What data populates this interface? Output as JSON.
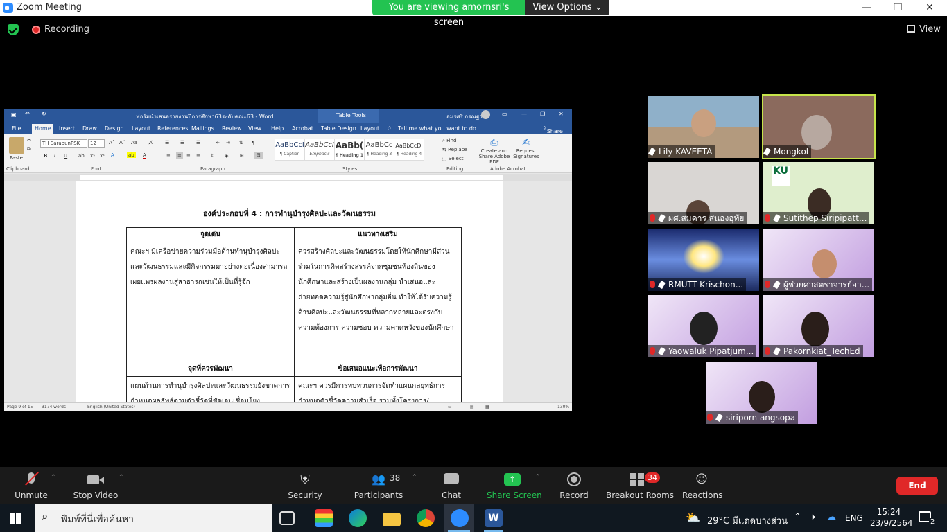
{
  "window": {
    "title": "Zoom Meeting"
  },
  "banner": {
    "text": "You are viewing amornsri's screen",
    "view_options": "View Options"
  },
  "top": {
    "recording": "Recording",
    "view": "View"
  },
  "word": {
    "title": "ฟอร์มนำเสนอรายงานปีการศึกษา63ระดับคณะ63 - Word",
    "table_tools": "Table Tools",
    "user": "อมรศรี กรณฐาน",
    "tabs": [
      "File",
      "Home",
      "Insert",
      "Draw",
      "Design",
      "Layout",
      "References",
      "Mailings",
      "Review",
      "View",
      "Help",
      "Acrobat",
      "Table Design",
      "Layout"
    ],
    "tell_me": "Tell me what you want to do",
    "share": "Share",
    "font_name": "TH SarabunPSK",
    "font_size": "12",
    "paste": "Paste",
    "groups": [
      "Clipboard",
      "Font",
      "Paragraph",
      "Styles",
      "Editing",
      "Adobe Acrobat"
    ],
    "styles": [
      {
        "sample": "AaBbCcI",
        "name": "¶ Caption"
      },
      {
        "sample": "AaBbCcI",
        "name": "Emphasis"
      },
      {
        "sample": "AaBb(",
        "name": "¶ Heading 1"
      },
      {
        "sample": "AaBbCc",
        "name": "¶ Heading 3"
      },
      {
        "sample": "AaBbCcDi",
        "name": "¶ Heading 4"
      }
    ],
    "editing": [
      "Find",
      "Replace",
      "Select"
    ],
    "acrobat": [
      "Create and Share Adobe PDF",
      "Request Signatures"
    ],
    "doc": {
      "heading": "องค์ประกอบที่ 4 :  การทำนุบำรุงศิลปะและวัฒนธรรม",
      "col1": "จุดเด่น",
      "col2": "แนวทางเสริม",
      "cell1": "คณะฯ มีเครือข่ายความร่วมมือด้านทำนุบำรุงศิลปะและวัฒนธรรมและมีกิจกรรมมาอย่างต่อเนื่องสามารถเผยแพร่ผลงานสู่สาธารณชนให้เป็นที่รู้จัก",
      "cell2": "ควรสร้างศิลปะและวัฒนธรรมโดยให้นักศึกษามีส่วนร่วมในการคิดสร้างสรรค์จากชุมชนท้องถิ่นของนักศึกษาและสร้างเป็นผลงานกลุ่ม นำเสนอและถ่ายทอดความรู้สู่นักศึกษากลุ่มอื่น ทำให้ได้รับความรู้ด้านศิลปะและวัฒนธรรมที่หลากหลายและตรงกับความต้องการ ความชอบ ความคาดหวังของนักศึกษา",
      "col3": "จุดที่ควรพัฒนา",
      "col4": "ข้อเสนอแนะเพื่อการพัฒนา",
      "cell3": "แผนด้านการทำนุบำรุงศิลปะและวัฒนธรรมยังขาดการกำหนดผลลัพธ์ตามตัวชี้วัดที่ชัดเจนเชื่อมโยง",
      "cell4": "คณะฯ ควรมีการทบทวนการจัดทำแผนกลยุทธ์การกำหนดตัวชี้วัดความสำเร็จ รวมทั้งโครงการ/"
    },
    "status": {
      "page": "Page 9 of 15",
      "words": "3174 words",
      "lang": "English (United States)",
      "zoom": "130%"
    }
  },
  "participants": [
    {
      "name": "Lily KAVEETA",
      "muted": false
    },
    {
      "name": "Mongkol",
      "muted": false
    },
    {
      "name": "ผศ.สมคาร  สนองอุทัย",
      "muted": true
    },
    {
      "name": "Sutithep Siripipatt...",
      "muted": true
    },
    {
      "name": "RMUTT-Krischon...",
      "muted": true
    },
    {
      "name": "ผู้ช่วยศาสตราจารย์อา...",
      "muted": true
    },
    {
      "name": "Yaowaluk Pipatjum...",
      "muted": true
    },
    {
      "name": "Pakornkiat_TechEd",
      "muted": true
    },
    {
      "name": "siriporn angsopa",
      "muted": true
    }
  ],
  "toolbar": {
    "unmute": "Unmute",
    "stop_video": "Stop Video",
    "security": "Security",
    "participants": "Participants",
    "participants_count": "38",
    "chat": "Chat",
    "share_screen": "Share Screen",
    "record": "Record",
    "breakout": "Breakout Rooms",
    "breakout_count": "34",
    "reactions": "Reactions",
    "end": "End"
  },
  "taskbar": {
    "search": "พิมพ์ที่นี่เพื่อค้นหา",
    "weather": "29°C  มีแดดบางส่วน",
    "lang": "ENG",
    "time": "15:24",
    "date": "23/9/2564",
    "notifications": "2"
  },
  "colors": {
    "zoom_blue": "#2d8cff",
    "green": "#23c351",
    "red": "#e02828",
    "word_blue": "#2b579a"
  }
}
